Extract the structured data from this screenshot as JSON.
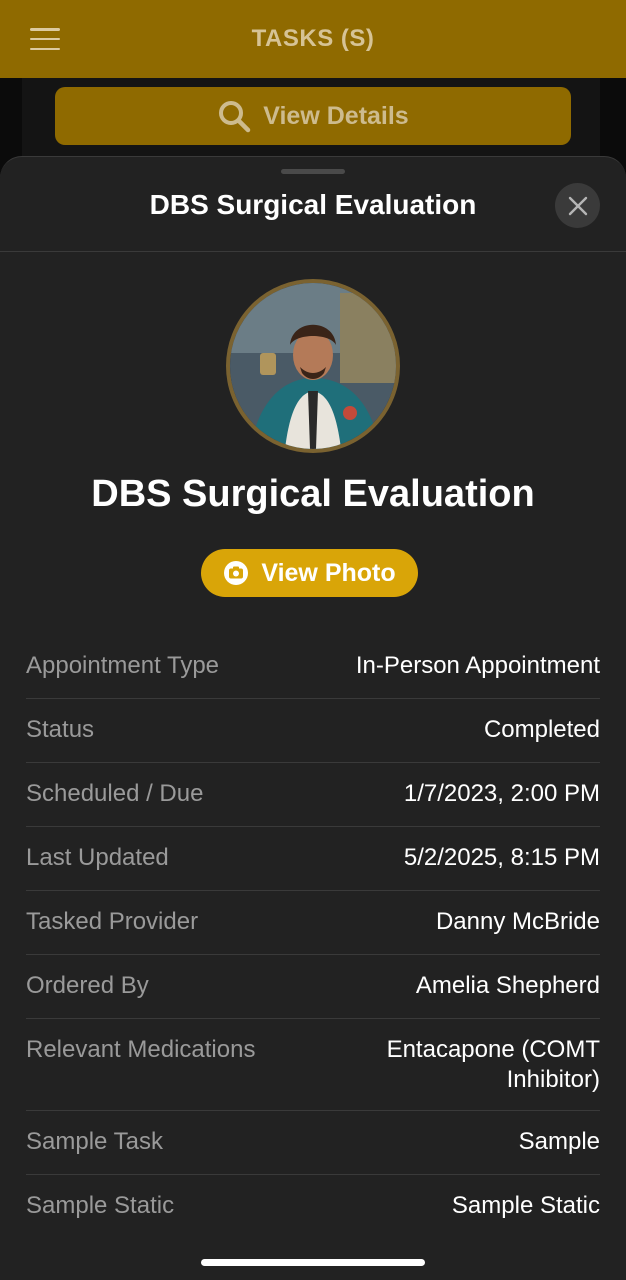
{
  "app_bar": {
    "title": "TASKS (S)",
    "menu_icon": "hamburger-menu-icon",
    "background_color": "#8f6a00"
  },
  "view_details_button": {
    "label": "View Details",
    "icon": "search-icon"
  },
  "sheet": {
    "header_title": "DBS Surgical Evaluation",
    "close_icon": "close-icon",
    "main_title": "DBS Surgical Evaluation",
    "photo_button_label": "View Photo",
    "photo_button_icon": "camera-icon",
    "accent_color": "#d9a508",
    "details": [
      {
        "label": "Appointment Type",
        "value": "In-Person Appointment"
      },
      {
        "label": "Status",
        "value": "Completed"
      },
      {
        "label": "Scheduled / Due",
        "value": "1/7/2023, 2:00 PM"
      },
      {
        "label": "Last Updated",
        "value": "5/2/2025, 8:15 PM"
      },
      {
        "label": "Tasked Provider",
        "value": "Danny McBride"
      },
      {
        "label": "Ordered By",
        "value": "Amelia Shepherd"
      },
      {
        "label": "Relevant Medications",
        "value": "Entacapone (COMT Inhibitor)"
      },
      {
        "label": "Sample Task",
        "value": "Sample"
      },
      {
        "label": "Sample Static",
        "value": "Sample Static"
      }
    ]
  }
}
